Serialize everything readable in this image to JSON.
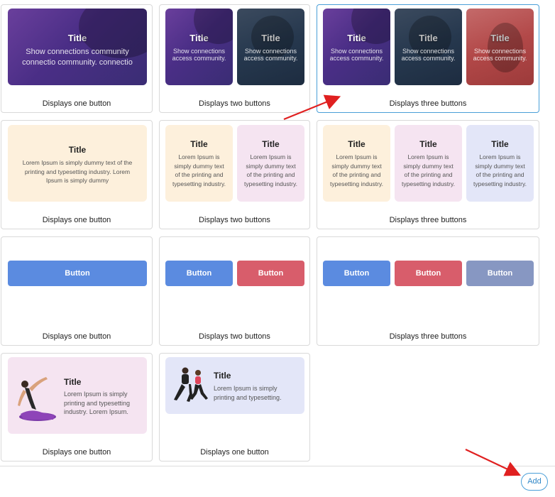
{
  "title_text": "Title",
  "img_text_wide": "Show connections  community connectio community. connectio",
  "img_text_small": "Show connections access community.",
  "pastel_text_wide": "Lorem Ipsum is simply dummy text of the printing and typesetting industry. Lorem Ipsum is simply dummy",
  "pastel_text_small": "Lorem Ipsum is simply dummy text of the printing and typesetting industry.",
  "button_label": "Button",
  "person_text_1": "Lorem Ipsum is simply printing and typesetting industry. Lorem Ipsum.",
  "person_text_2": "Lorem Ipsum is simply printing and typesetting.",
  "captions": {
    "one": "Displays one button",
    "two": "Displays two buttons",
    "three": "Displays three buttons"
  },
  "colors": {
    "button_blue": "#5b8be0",
    "button_red": "#d85d6b",
    "button_grey": "#8797c2",
    "selected_border": "#4a9fd8",
    "annotation_arrow": "#e02020"
  },
  "icons": [
    "yoga-pose-figure",
    "fitness-couple-figure"
  ],
  "footer": {
    "add_label": "Add"
  }
}
